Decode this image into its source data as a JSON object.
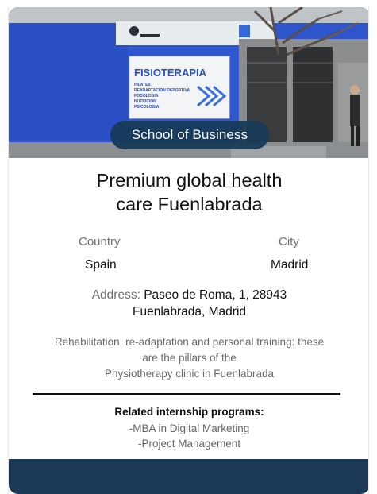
{
  "hero": {
    "badge_label": "School of Business",
    "sign_title": "FISIOTERAPIA",
    "sign_lines": [
      "PILATES",
      "READAPTACION DEPORTIVA",
      "PODOLOGIA",
      "NUTRICION",
      "PSICOLOGIA"
    ]
  },
  "center": {
    "title_line1": "Premium global health",
    "title_line2": "care Fuenlabrada",
    "country_label": "Country",
    "country_value": "Spain",
    "city_label": "City",
    "city_value": "Madrid",
    "address_label": "Address:",
    "address_line1": "Paseo de Roma, 1, 28943",
    "address_line2": "Fuenlabrada, Madrid",
    "description_line1": "Rehabilitation, re-adaptation and personal training: these",
    "description_line2": "are the pillars of the",
    "description_line3": "Physiotherapy clinic in Fuenlabrada"
  },
  "internships": {
    "heading": "Related internship programs:",
    "programs": [
      "-MBA in Digital Marketing",
      "-Project Management"
    ]
  },
  "colors": {
    "badge_bg": "#163a58",
    "footer_bg": "#1b3856",
    "building_blue": "#2c52c8"
  }
}
